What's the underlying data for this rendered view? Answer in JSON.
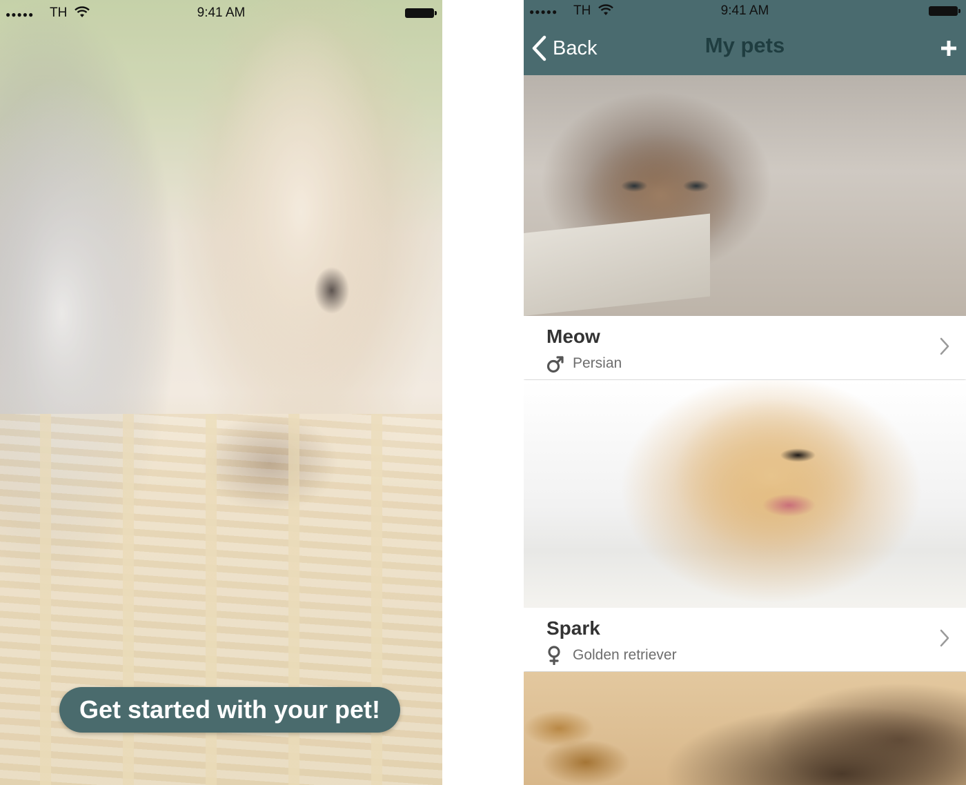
{
  "status_bar": {
    "signal": "●●●●●",
    "carrier": "TH",
    "time": "9:41 AM"
  },
  "welcome": {
    "cta_label": "Get started with your pet!"
  },
  "pets_screen": {
    "back_label": "Back",
    "title": "My pets",
    "pets": [
      {
        "name": "Meow",
        "breed": "Persian",
        "gender": "male",
        "photo": "kitten"
      },
      {
        "name": "Spark",
        "breed": "Golden retriever",
        "gender": "female",
        "photo": "golden-retriever-puppy"
      },
      {
        "photo": "chipmunk"
      }
    ]
  },
  "colors": {
    "nav_bar": "#4a6b6f",
    "cta_background": "#4a6b6d",
    "title_text": "#1f3d40"
  }
}
